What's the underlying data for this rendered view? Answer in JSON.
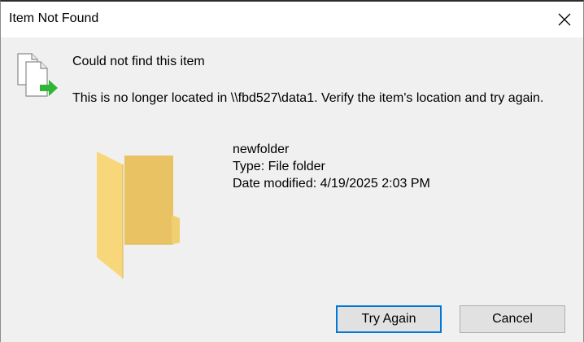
{
  "window": {
    "title": "Item Not Found",
    "close_icon": "close-icon"
  },
  "dialog": {
    "heading": "Could not find this item",
    "message": "This is no longer located in \\\\fbd527\\data1. Verify the item's location and try again.",
    "icon": "missing-file-icon"
  },
  "item": {
    "name": "newfolder",
    "type": "Type: File folder",
    "modified": "Date modified: 4/19/2025 2:03 PM",
    "icon": "folder-icon"
  },
  "buttons": {
    "try_again": "Try Again",
    "cancel": "Cancel"
  },
  "colors": {
    "accent": "#0078d7",
    "folder": "#f3cf6b",
    "arrow": "#2fb537"
  }
}
